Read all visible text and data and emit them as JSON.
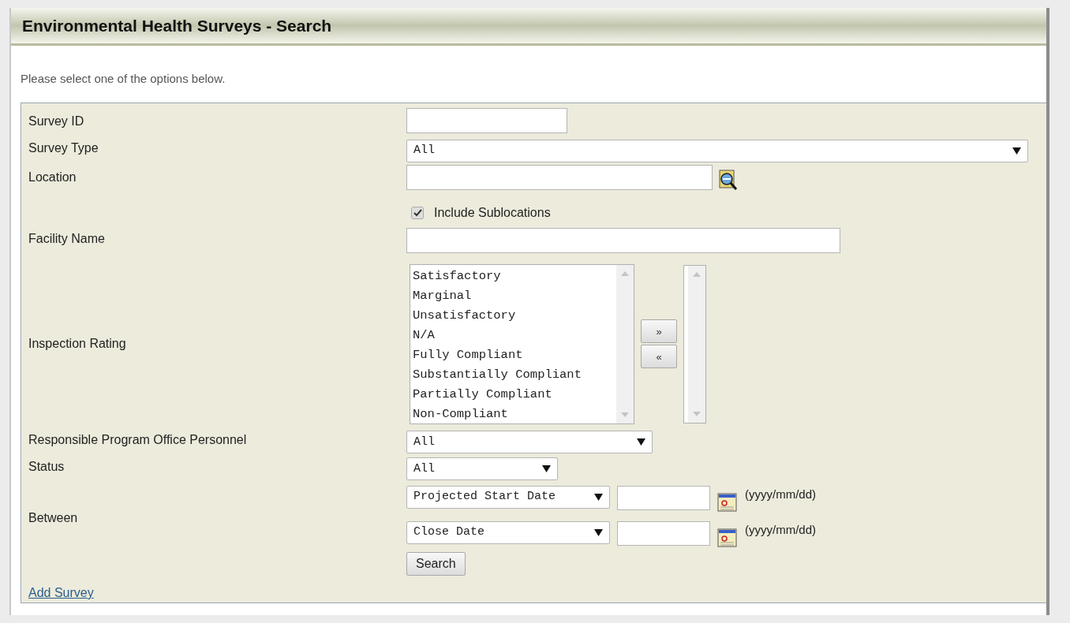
{
  "title": "Environmental Health Surveys - Search",
  "instructions": "Please select one of the options below.",
  "survey_id": {
    "label": "Survey ID"
  },
  "survey_type": {
    "label": "Survey Type",
    "value": "All"
  },
  "location": {
    "label": "Location",
    "checkbox": {
      "label": "Include Sublocations",
      "checked": true
    }
  },
  "facility_name": {
    "label": "Facility Name"
  },
  "inspection_rating": {
    "label": "Inspection Rating",
    "available": [
      "Satisfactory",
      "Marginal",
      "Unsatisfactory",
      "N/A",
      "Fully Compliant",
      "Substantially Compliant",
      "Partially Compliant",
      "Non-Compliant"
    ],
    "add_button": "»",
    "remove_button": "«"
  },
  "personnel": {
    "label": "Responsible Program Office Personnel",
    "value": "All"
  },
  "status": {
    "label": "Status",
    "value": "All"
  },
  "between": {
    "label": "Between",
    "rows": [
      {
        "date_type": "Projected Start Date",
        "hint": "(yyyy/mm/dd)"
      },
      {
        "date_type": "Close Date",
        "hint": "(yyyy/mm/dd)"
      }
    ]
  },
  "search_button": "Search",
  "add_link": "Add Survey"
}
